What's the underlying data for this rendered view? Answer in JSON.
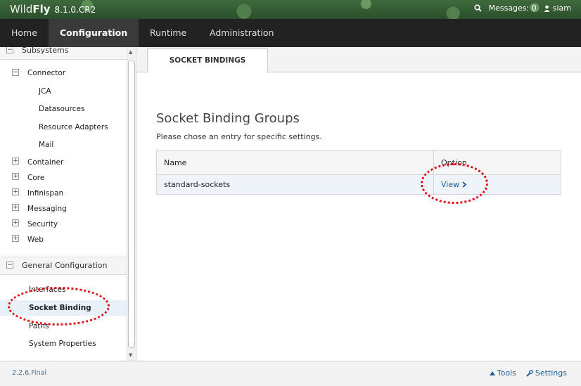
{
  "header": {
    "brand_light": "Wild",
    "brand_bold": "Fly",
    "version": "8.1.0.CR2",
    "messages_label": "Messages: 0",
    "user": "siam"
  },
  "nav": {
    "items": [
      {
        "label": "Home"
      },
      {
        "label": "Configuration",
        "active": true
      },
      {
        "label": "Runtime"
      },
      {
        "label": "Administration"
      }
    ]
  },
  "sidebar": {
    "subsystems_label": "Subsystems",
    "connector_label": "Connector",
    "connector_children": [
      "JCA",
      "Datasources",
      "Resource Adapters",
      "Mail"
    ],
    "collapsed_groups": [
      "Container",
      "Core",
      "Infinispan",
      "Messaging",
      "Security",
      "Web"
    ],
    "general_label": "General Configuration",
    "general_items": [
      "Interfaces",
      "Socket Binding",
      "Paths",
      "System Properties"
    ],
    "selected_item": "Socket Binding"
  },
  "content": {
    "tab_label": "SOCKET BINDINGS",
    "title": "Socket Binding Groups",
    "description": "Please chose an entry for specific settings.",
    "table": {
      "headers": [
        "Name",
        "Option"
      ],
      "rows": [
        {
          "name": "standard-sockets",
          "option": "View"
        }
      ]
    }
  },
  "footer": {
    "version": "2.2.6.Final",
    "tools_label": "Tools",
    "settings_label": "Settings"
  },
  "colors": {
    "nav_bg": "#222222",
    "link": "#1e5f99",
    "annotation": "#e0101a",
    "selected_row": "#eef4f9"
  }
}
